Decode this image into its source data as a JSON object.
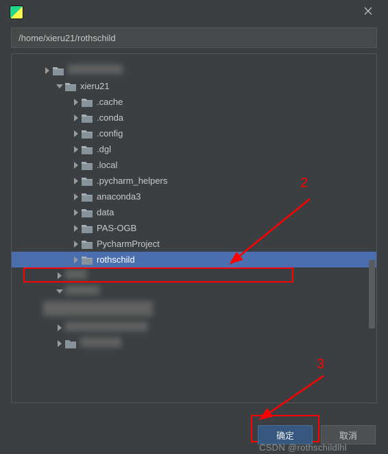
{
  "window": {
    "path": "/home/xieru21/rothschild"
  },
  "tree": {
    "root_expanded_label": "xieru21",
    "children": [
      {
        "label": ".cache"
      },
      {
        "label": ".conda"
      },
      {
        "label": ".config"
      },
      {
        "label": ".dgl"
      },
      {
        "label": ".local"
      },
      {
        "label": ".pycharm_helpers"
      },
      {
        "label": "anaconda3"
      },
      {
        "label": "data"
      },
      {
        "label": "PAS-OGB"
      },
      {
        "label": "PycharmProject"
      },
      {
        "label": "rothschild",
        "selected": true
      }
    ]
  },
  "buttons": {
    "ok": "确定",
    "cancel": "取消"
  },
  "annotations": {
    "label2": "2",
    "label3": "3"
  },
  "watermark": "CSDN @rothschildlhl"
}
